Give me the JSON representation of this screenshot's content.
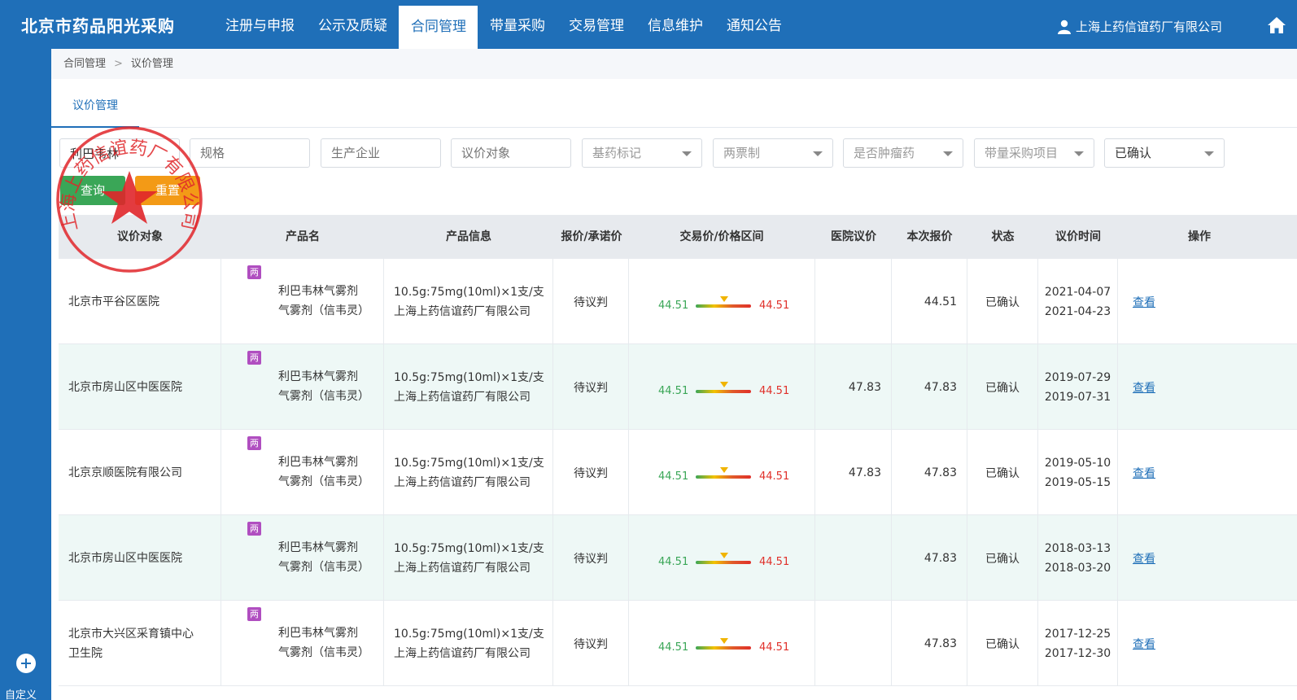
{
  "brand": "北京市药品阳光采购",
  "nav": [
    "注册与申报",
    "公示及质疑",
    "合同管理",
    "带量采购",
    "交易管理",
    "信息维护",
    "通知公告"
  ],
  "nav_active": 2,
  "company": "上海上药信谊药厂有限公司",
  "breadcrumb": {
    "level1": "合同管理",
    "sep": ">",
    "level2": "议价管理"
  },
  "tab": "议价管理",
  "filters": {
    "product_value": "利巴韦林",
    "spec_placeholder": "规格",
    "manufacturer_placeholder": "生产企业",
    "target_placeholder": "议价对象",
    "essential_drug": "基药标记",
    "two_invoice": "两票制",
    "tumor_drug": "是否肿瘤药",
    "vbp_project": "带量采购项目",
    "status": "已确认"
  },
  "buttons": {
    "query": "查询",
    "reset": "重置"
  },
  "table": {
    "headers": [
      "议价对象",
      "产品名",
      "产品信息",
      "报价/承诺价",
      "交易价/价格区间",
      "医院议价",
      "本次报价",
      "状态",
      "议价时间",
      "操作"
    ],
    "rows": [
      {
        "badge": "两",
        "hospital": "北京市平谷区医院",
        "product_line1": "利巴韦林气雾剂",
        "product_line2": "气雾剂（信韦灵）",
        "spec": "10.5g:75mg(10ml)×1支/支",
        "manufacturer": "上海上药信谊药厂有限公司",
        "quote": "待议判",
        "price_low": "44.51",
        "price_high": "44.51",
        "hospital_price": "",
        "current_quote": "44.51",
        "status": "已确认",
        "date1": "2021-04-07",
        "date2": "2021-04-23",
        "action": "查看"
      },
      {
        "badge": "两",
        "hospital": "北京市房山区中医医院",
        "product_line1": "利巴韦林气雾剂",
        "product_line2": "气雾剂（信韦灵）",
        "spec": "10.5g:75mg(10ml)×1支/支",
        "manufacturer": "上海上药信谊药厂有限公司",
        "quote": "待议判",
        "price_low": "44.51",
        "price_high": "44.51",
        "hospital_price": "47.83",
        "current_quote": "47.83",
        "status": "已确认",
        "date1": "2019-07-29",
        "date2": "2019-07-31",
        "action": "查看"
      },
      {
        "badge": "两",
        "hospital": "北京京顺医院有限公司",
        "product_line1": "利巴韦林气雾剂",
        "product_line2": "气雾剂（信韦灵）",
        "spec": "10.5g:75mg(10ml)×1支/支",
        "manufacturer": "上海上药信谊药厂有限公司",
        "quote": "待议判",
        "price_low": "44.51",
        "price_high": "44.51",
        "hospital_price": "47.83",
        "current_quote": "47.83",
        "status": "已确认",
        "date1": "2019-05-10",
        "date2": "2019-05-15",
        "action": "查看"
      },
      {
        "badge": "两",
        "hospital": "北京市房山区中医医院",
        "product_line1": "利巴韦林气雾剂",
        "product_line2": "气雾剂（信韦灵）",
        "spec": "10.5g:75mg(10ml)×1支/支",
        "manufacturer": "上海上药信谊药厂有限公司",
        "quote": "待议判",
        "price_low": "44.51",
        "price_high": "44.51",
        "hospital_price": "",
        "current_quote": "47.83",
        "status": "已确认",
        "date1": "2018-03-13",
        "date2": "2018-03-20",
        "action": "查看"
      },
      {
        "badge": "两",
        "hospital": "北京市大兴区采育镇中心卫生院",
        "product_line1": "利巴韦林气雾剂",
        "product_line2": "气雾剂（信韦灵）",
        "spec": "10.5g:75mg(10ml)×1支/支",
        "manufacturer": "上海上药信谊药厂有限公司",
        "quote": "待议判",
        "price_low": "44.51",
        "price_high": "44.51",
        "hospital_price": "",
        "current_quote": "47.83",
        "status": "已确认",
        "date1": "2017-12-25",
        "date2": "2017-12-30",
        "action": "查看"
      }
    ]
  },
  "sidebar": {
    "custom": "自定义"
  },
  "seal_text": "上海上药信谊药厂有限公司",
  "colors": {
    "primary": "#1f6fb8",
    "query_btn": "#3aa657",
    "reset_btn": "#f39a16",
    "badge": "#b04ec0",
    "seal": "#e0262a",
    "row_alt": "#eef8f6"
  }
}
